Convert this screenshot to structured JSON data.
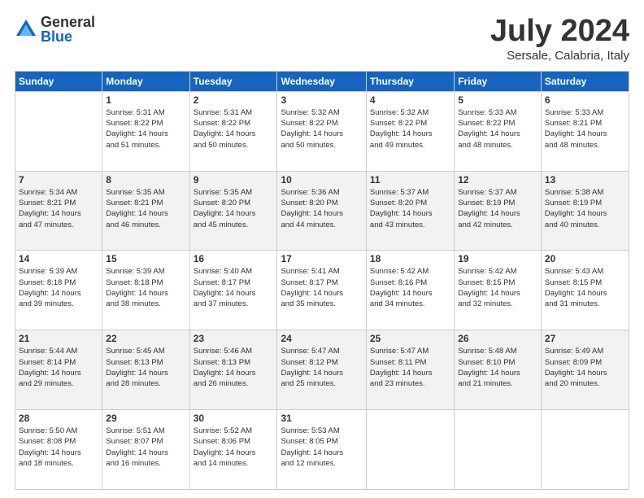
{
  "logo": {
    "general": "General",
    "blue": "Blue"
  },
  "title": {
    "month": "July 2024",
    "location": "Sersale, Calabria, Italy"
  },
  "days_header": [
    "Sunday",
    "Monday",
    "Tuesday",
    "Wednesday",
    "Thursday",
    "Friday",
    "Saturday"
  ],
  "weeks": [
    [
      {
        "day": "",
        "info": ""
      },
      {
        "day": "1",
        "info": "Sunrise: 5:31 AM\nSunset: 8:22 PM\nDaylight: 14 hours\nand 51 minutes."
      },
      {
        "day": "2",
        "info": "Sunrise: 5:31 AM\nSunset: 8:22 PM\nDaylight: 14 hours\nand 50 minutes."
      },
      {
        "day": "3",
        "info": "Sunrise: 5:32 AM\nSunset: 8:22 PM\nDaylight: 14 hours\nand 50 minutes."
      },
      {
        "day": "4",
        "info": "Sunrise: 5:32 AM\nSunset: 8:22 PM\nDaylight: 14 hours\nand 49 minutes."
      },
      {
        "day": "5",
        "info": "Sunrise: 5:33 AM\nSunset: 8:22 PM\nDaylight: 14 hours\nand 48 minutes."
      },
      {
        "day": "6",
        "info": "Sunrise: 5:33 AM\nSunset: 8:21 PM\nDaylight: 14 hours\nand 48 minutes."
      }
    ],
    [
      {
        "day": "7",
        "info": "Sunrise: 5:34 AM\nSunset: 8:21 PM\nDaylight: 14 hours\nand 47 minutes."
      },
      {
        "day": "8",
        "info": "Sunrise: 5:35 AM\nSunset: 8:21 PM\nDaylight: 14 hours\nand 46 minutes."
      },
      {
        "day": "9",
        "info": "Sunrise: 5:35 AM\nSunset: 8:20 PM\nDaylight: 14 hours\nand 45 minutes."
      },
      {
        "day": "10",
        "info": "Sunrise: 5:36 AM\nSunset: 8:20 PM\nDaylight: 14 hours\nand 44 minutes."
      },
      {
        "day": "11",
        "info": "Sunrise: 5:37 AM\nSunset: 8:20 PM\nDaylight: 14 hours\nand 43 minutes."
      },
      {
        "day": "12",
        "info": "Sunrise: 5:37 AM\nSunset: 8:19 PM\nDaylight: 14 hours\nand 42 minutes."
      },
      {
        "day": "13",
        "info": "Sunrise: 5:38 AM\nSunset: 8:19 PM\nDaylight: 14 hours\nand 40 minutes."
      }
    ],
    [
      {
        "day": "14",
        "info": "Sunrise: 5:39 AM\nSunset: 8:18 PM\nDaylight: 14 hours\nand 39 minutes."
      },
      {
        "day": "15",
        "info": "Sunrise: 5:39 AM\nSunset: 8:18 PM\nDaylight: 14 hours\nand 38 minutes."
      },
      {
        "day": "16",
        "info": "Sunrise: 5:40 AM\nSunset: 8:17 PM\nDaylight: 14 hours\nand 37 minutes."
      },
      {
        "day": "17",
        "info": "Sunrise: 5:41 AM\nSunset: 8:17 PM\nDaylight: 14 hours\nand 35 minutes."
      },
      {
        "day": "18",
        "info": "Sunrise: 5:42 AM\nSunset: 8:16 PM\nDaylight: 14 hours\nand 34 minutes."
      },
      {
        "day": "19",
        "info": "Sunrise: 5:42 AM\nSunset: 8:15 PM\nDaylight: 14 hours\nand 32 minutes."
      },
      {
        "day": "20",
        "info": "Sunrise: 5:43 AM\nSunset: 8:15 PM\nDaylight: 14 hours\nand 31 minutes."
      }
    ],
    [
      {
        "day": "21",
        "info": "Sunrise: 5:44 AM\nSunset: 8:14 PM\nDaylight: 14 hours\nand 29 minutes."
      },
      {
        "day": "22",
        "info": "Sunrise: 5:45 AM\nSunset: 8:13 PM\nDaylight: 14 hours\nand 28 minutes."
      },
      {
        "day": "23",
        "info": "Sunrise: 5:46 AM\nSunset: 8:13 PM\nDaylight: 14 hours\nand 26 minutes."
      },
      {
        "day": "24",
        "info": "Sunrise: 5:47 AM\nSunset: 8:12 PM\nDaylight: 14 hours\nand 25 minutes."
      },
      {
        "day": "25",
        "info": "Sunrise: 5:47 AM\nSunset: 8:11 PM\nDaylight: 14 hours\nand 23 minutes."
      },
      {
        "day": "26",
        "info": "Sunrise: 5:48 AM\nSunset: 8:10 PM\nDaylight: 14 hours\nand 21 minutes."
      },
      {
        "day": "27",
        "info": "Sunrise: 5:49 AM\nSunset: 8:09 PM\nDaylight: 14 hours\nand 20 minutes."
      }
    ],
    [
      {
        "day": "28",
        "info": "Sunrise: 5:50 AM\nSunset: 8:08 PM\nDaylight: 14 hours\nand 18 minutes."
      },
      {
        "day": "29",
        "info": "Sunrise: 5:51 AM\nSunset: 8:07 PM\nDaylight: 14 hours\nand 16 minutes."
      },
      {
        "day": "30",
        "info": "Sunrise: 5:52 AM\nSunset: 8:06 PM\nDaylight: 14 hours\nand 14 minutes."
      },
      {
        "day": "31",
        "info": "Sunrise: 5:53 AM\nSunset: 8:05 PM\nDaylight: 14 hours\nand 12 minutes."
      },
      {
        "day": "",
        "info": ""
      },
      {
        "day": "",
        "info": ""
      },
      {
        "day": "",
        "info": ""
      }
    ]
  ]
}
